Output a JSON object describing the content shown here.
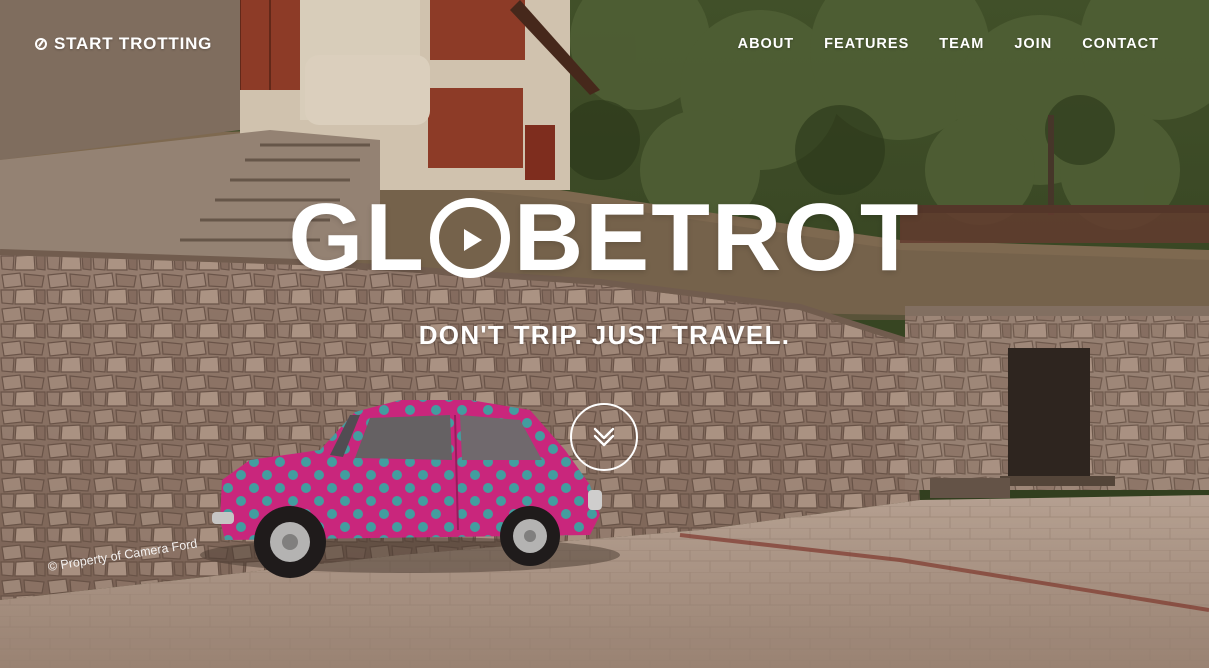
{
  "brand": {
    "icon": "compass-icon",
    "label": "START TROTTING"
  },
  "nav": {
    "items": [
      {
        "label": "ABOUT"
      },
      {
        "label": "FEATURES"
      },
      {
        "label": "TEAM"
      },
      {
        "label": "JOIN"
      },
      {
        "label": "CONTACT"
      }
    ]
  },
  "hero": {
    "logo_before": "GL",
    "logo_icon": "play-icon",
    "logo_after": "BETROT",
    "tagline": "DON'T TRIP. JUST TRAVEL.",
    "scroll_icon": "double-chevron-down-icon",
    "credit": "© Property of Camera Ford"
  },
  "colors": {
    "text": "#ffffff",
    "car_pink": "#e0278a",
    "car_dots": "#3fb6b4",
    "wall": "#9b8275",
    "ground": "#b59c8c",
    "foliage": "#3f5228"
  }
}
